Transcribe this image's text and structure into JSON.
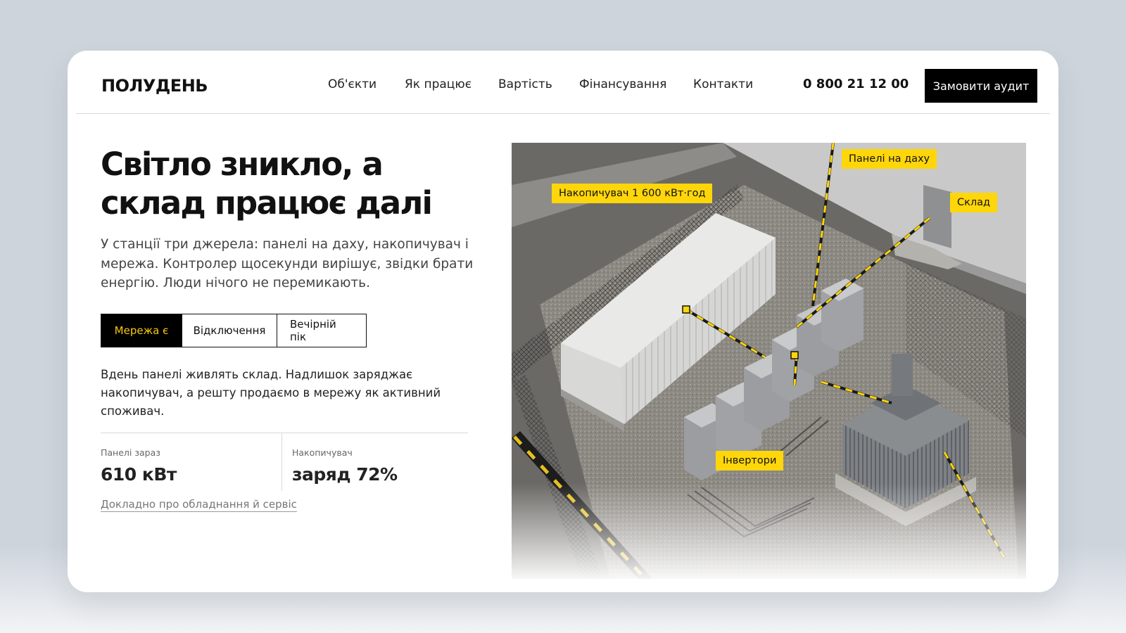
{
  "brand": {
    "logo": "ПОЛУДЕНЬ"
  },
  "nav": {
    "items": [
      "Об'єкти",
      "Як працює",
      "Вартість",
      "Фінансування",
      "Контакти"
    ],
    "phone": "0 800 21 12 00",
    "cta_label": "Замовити аудит"
  },
  "hero": {
    "title_line1": "Світло зникло, а",
    "title_line2": "склад працює далі",
    "lead": "У станції три джерела: панелі на даху, накопичувач і мережа. Контролер щосекунди вирішує, звідки брати енергію. Люди нічого не перемикають."
  },
  "modes": {
    "tabs": [
      "Мережа є",
      "Відключення",
      "Вечірній пік"
    ],
    "active_index": 0,
    "description": "Вдень панелі живлять склад. Надлишок заряджає накопичувач, а решту продаємо в мережу як активний споживач."
  },
  "stats": [
    {
      "label": "Панелі зараз",
      "value": "610 кВт"
    },
    {
      "label": "Накопичувач",
      "value": "заряд 72%"
    }
  ],
  "more_link": "Докладно про обладнання й сервіс",
  "photo": {
    "labels": {
      "roof": "Панелі на даху",
      "battery": "Накопичувач 1 600 кВт·год",
      "warehouse": "Склад",
      "inverters": "Інвертори"
    }
  },
  "colors": {
    "accent": "#ffd60a",
    "dark": "#000000"
  }
}
